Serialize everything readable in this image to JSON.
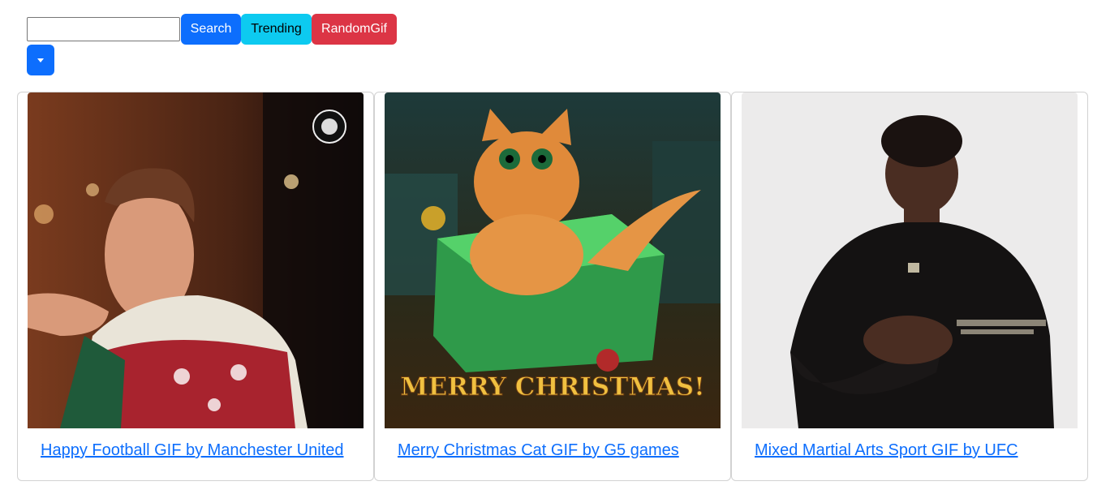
{
  "search": {
    "value": "",
    "placeholder": ""
  },
  "buttons": {
    "search_label": "Search",
    "trending_label": "Trending",
    "random_label": "RandomGif"
  },
  "dropdown": {
    "icon": "caret-down-icon"
  },
  "colors": {
    "primary": "#0d6efd",
    "info": "#0dcaf0",
    "danger": "#dc3545",
    "link": "#0d6efd"
  },
  "gifs": [
    {
      "title": "Happy Football GIF by Manchester United"
    },
    {
      "title": "Merry Christmas Cat GIF by G5 games",
      "image_text": "MERRY CHRISTMAS!"
    },
    {
      "title": "Mixed Martial Arts Sport GIF by UFC"
    }
  ]
}
